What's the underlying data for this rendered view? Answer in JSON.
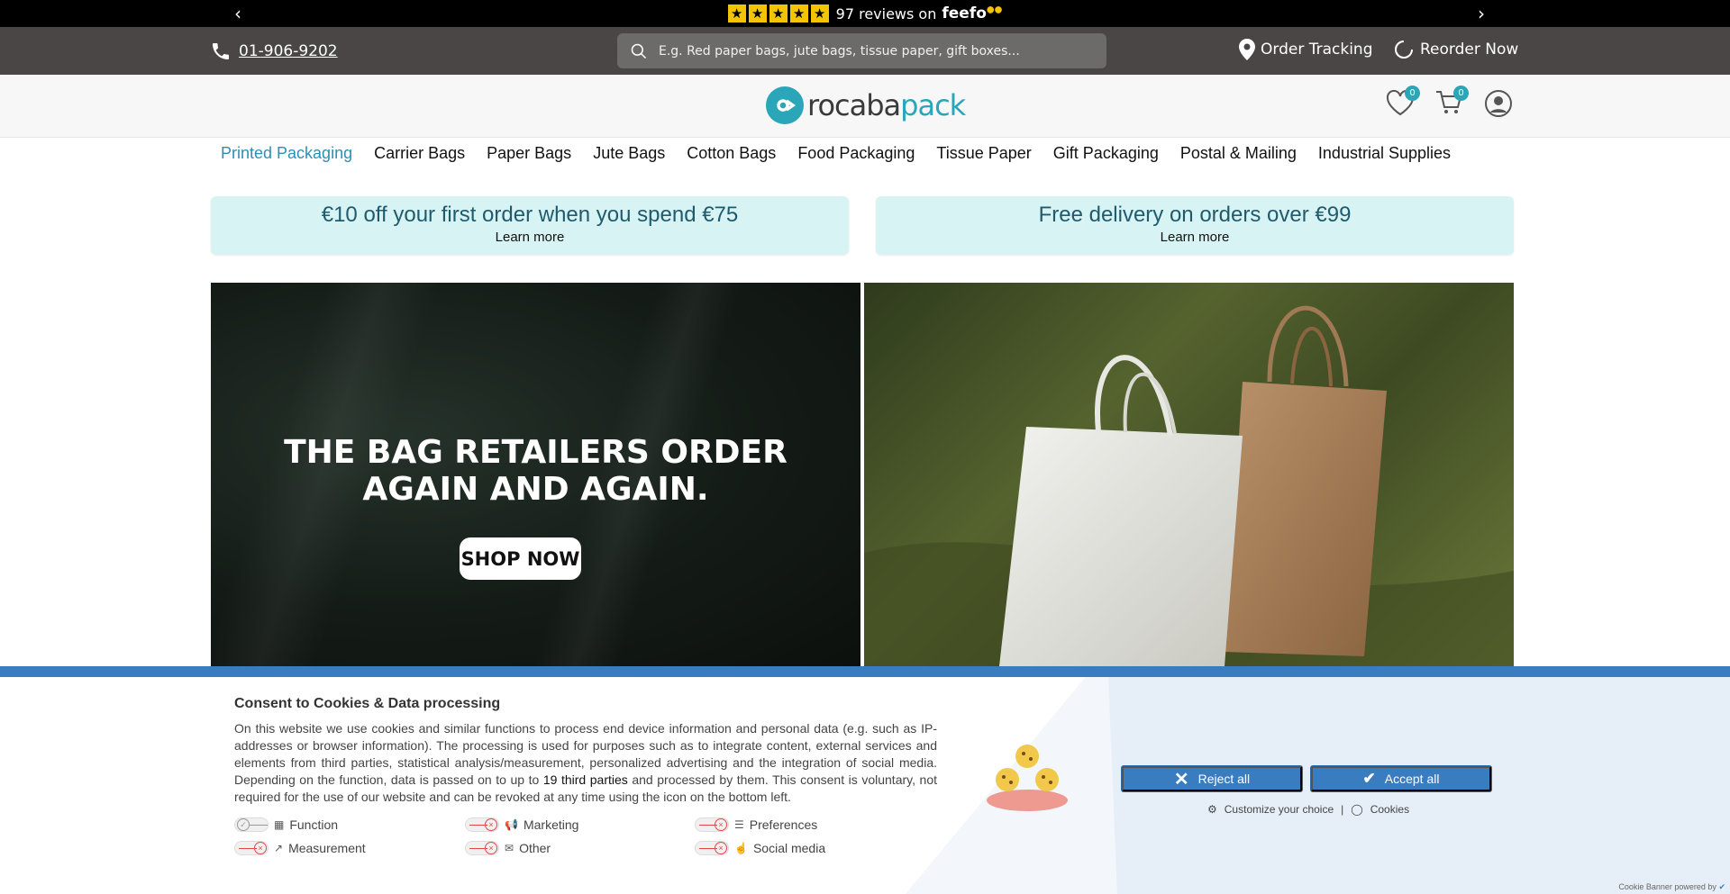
{
  "topbar": {
    "stars_count": 5,
    "reviews_text": "97 reviews on",
    "brand": "feefo"
  },
  "utility": {
    "phone": "01-906-9202",
    "search_placeholder": "E.g. Red paper bags, jute bags, tissue paper, gift boxes...",
    "order_tracking": "Order Tracking",
    "reorder_now": "Reorder Now"
  },
  "header": {
    "logo_part1": "rocaba",
    "logo_part2": "pack",
    "wishlist_count": "0",
    "cart_count": "0"
  },
  "nav": {
    "items": [
      "Printed Packaging",
      "Carrier Bags",
      "Paper Bags",
      "Jute Bags",
      "Cotton Bags",
      "Food Packaging",
      "Tissue Paper",
      "Gift Packaging",
      "Postal & Mailing",
      "Industrial Supplies"
    ],
    "active": "Printed Packaging"
  },
  "promos": [
    {
      "title": "€10 off your first order when you spend €75",
      "link": "Learn more"
    },
    {
      "title": "Free delivery on orders over €99",
      "link": "Learn more"
    }
  ],
  "hero": {
    "title_line1": "THE BAG RETAILERS ORDER",
    "title_line2": "AGAIN AND AGAIN.",
    "cta": "SHOP NOW"
  },
  "cookie": {
    "title": "Consent to Cookies & Data processing",
    "body_before": "On this website we use cookies and similar functions to process end device information and personal data (e.g. such as IP-addresses or browser information). The processing is used for purposes such as to integrate content, external services and elements from third parties, statistical analysis/measurement, personalized advertising and the integration of social media. Depending on the function, data is passed on to up to ",
    "body_link": "19 third parties",
    "body_after": " and processed by them. This consent is voluntary, not required for the use of our website and can be revoked at any time using the icon on the bottom left.",
    "toggles": {
      "function": "Function",
      "marketing": "Marketing",
      "preferences": "Preferences",
      "measurement": "Measurement",
      "other": "Other",
      "social_media": "Social media"
    },
    "reject_all": "Reject all",
    "accept_all": "Accept all",
    "customize": "Customize your choice",
    "separator": "|",
    "cookies_link": "Cookies",
    "powered_by": "Cookie Banner powered by"
  },
  "colors": {
    "accent": "#2aa6b8",
    "nav_active": "#2e8eb8",
    "cookie_blue": "#3a7cc0",
    "star_yellow": "#f5c400",
    "utility_bg": "#4a4646"
  }
}
